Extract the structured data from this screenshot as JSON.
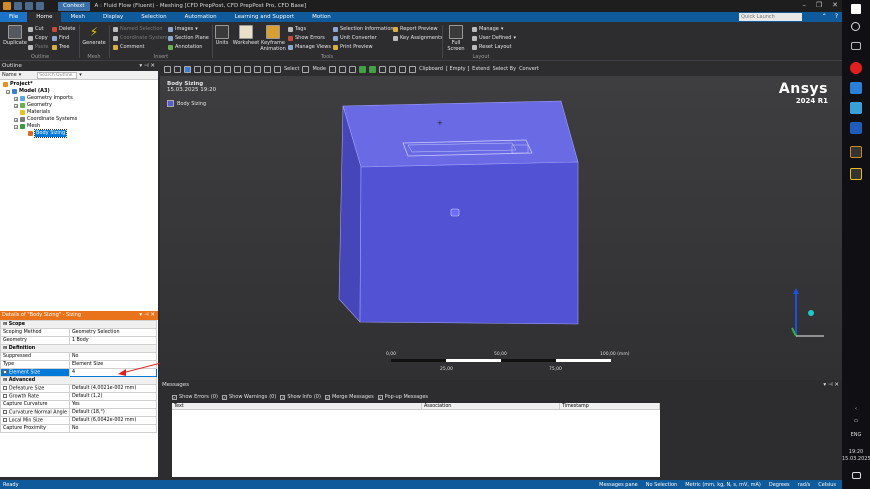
{
  "titlebar": {
    "context_tab": "Context",
    "title": "A : Fluid Flow (Fluent) - Meshing [CFD PrepPost, CFD PrepPost Pro, CFD Base]"
  },
  "menu": {
    "tabs": [
      "File",
      "Home",
      "Mesh",
      "Display",
      "Selection",
      "Automation",
      "Learning and Support",
      "Motion"
    ],
    "active": "Home",
    "quick_launch": "Quick Launch"
  },
  "ribbon": {
    "outline": {
      "duplicate": "Duplicate",
      "cut": "Cut",
      "copy": "Copy",
      "paste": "Paste",
      "delete": "Delete",
      "find": "Find",
      "tree": "Tree",
      "group": "Outline"
    },
    "mesh": {
      "generate": "Generate",
      "group": "Mesh"
    },
    "insert": {
      "named_selection": "Named Selection",
      "coordinate_system": "Coordinate System",
      "comment": "Comment",
      "images": "Images",
      "section_plane": "Section Plane",
      "annotation": "Annotation",
      "group": "Insert"
    },
    "tools": {
      "units": "Units",
      "worksheet": "Worksheet",
      "keyframe_animation": "Keyframe Animation",
      "tags": "Tags",
      "show_errors": "Show Errors",
      "manage_views": "Manage Views",
      "selection_information": "Selection Information",
      "unit_converter": "Unit Converter",
      "print_preview": "Print Preview",
      "report_preview": "Report Preview",
      "key_assignments": "Key Assignments",
      "group": "Tools"
    },
    "layout": {
      "full_screen": "Full Screen",
      "manage": "Manage",
      "user_defined": "User Defined",
      "reset_layout": "Reset Layout",
      "group": "Layout"
    }
  },
  "outline": {
    "title": "Outline",
    "name_label": "Name",
    "search_placeholder": "Search Outline",
    "tree": [
      {
        "label": "Project*",
        "level": 0
      },
      {
        "label": "Model (A3)",
        "level": 1
      },
      {
        "label": "Geometry Imports",
        "level": 2
      },
      {
        "label": "Geometry",
        "level": 2
      },
      {
        "label": "Materials",
        "level": 2
      },
      {
        "label": "Coordinate Systems",
        "level": 2
      },
      {
        "label": "Mesh",
        "level": 2
      },
      {
        "label": "Body Sizing",
        "level": 3
      }
    ]
  },
  "details": {
    "title": "Details of \"Body Sizing\" - Sizing",
    "rows": [
      {
        "type": "group",
        "k": "Scope"
      },
      {
        "k": "Scoping Method",
        "v": "Geometry Selection"
      },
      {
        "k": "Geometry",
        "v": "1 Body"
      },
      {
        "type": "group",
        "k": "Definition"
      },
      {
        "k": "Suppressed",
        "v": "No"
      },
      {
        "k": "Type",
        "v": "Element Size"
      },
      {
        "k": "Element Size",
        "v": "4",
        "cb": true,
        "hl": true
      },
      {
        "type": "group",
        "k": "Advanced"
      },
      {
        "k": "Defeature Size",
        "v": "Default (4,0021e-002 mm)",
        "cb": true
      },
      {
        "k": "Growth Rate",
        "v": "Default (1,2)",
        "cb": true
      },
      {
        "k": "Capture Curvature",
        "v": "Yes"
      },
      {
        "k": "Curvature Normal Angle",
        "v": "Default (18,°)",
        "cb": true
      },
      {
        "k": "Local Min Size",
        "v": "Default (6,0042e-002 mm)",
        "cb": true
      },
      {
        "k": "Capture Proximity",
        "v": "No"
      }
    ]
  },
  "graphics_toolbar": {
    "select": "Select",
    "mode": "Mode",
    "clipboard": "Clipboard",
    "empty": "[ Empty ]",
    "extend": "Extend",
    "select_by": "Select By",
    "convert": "Convert"
  },
  "viewport": {
    "title": "Body Sizing",
    "date": "15.03.2025 19:20",
    "legend": "Body Sizing",
    "brand": "Ansys",
    "release": "2024 R1",
    "scale": {
      "top": [
        "0,00",
        "50,00",
        "100,00 (mm)"
      ],
      "bottom": [
        "25,00",
        "75,00"
      ]
    },
    "body_color": "#5656d6"
  },
  "messages": {
    "title": "Messages",
    "filters": [
      {
        "label": "Show Errors",
        "count": "(0)"
      },
      {
        "label": "Show Warnings",
        "count": "(0)"
      },
      {
        "label": "Show Info",
        "count": "(0)"
      },
      {
        "label": "Merge Messages"
      },
      {
        "label": "Pop-up Messages"
      }
    ],
    "columns": [
      "Text",
      "Association",
      "Timestamp"
    ]
  },
  "status": {
    "ready": "Ready",
    "messages_pane": "Messages pane",
    "no_selection": "No Selection",
    "units": "Metric (mm, kg, N, s, mV, mA)",
    "degrees": "Degrees",
    "rads": "rad/s",
    "celsius": "Celsius"
  },
  "taskbar": {
    "lang": "ENG",
    "time": "19:20",
    "date": "15.03.2025"
  }
}
